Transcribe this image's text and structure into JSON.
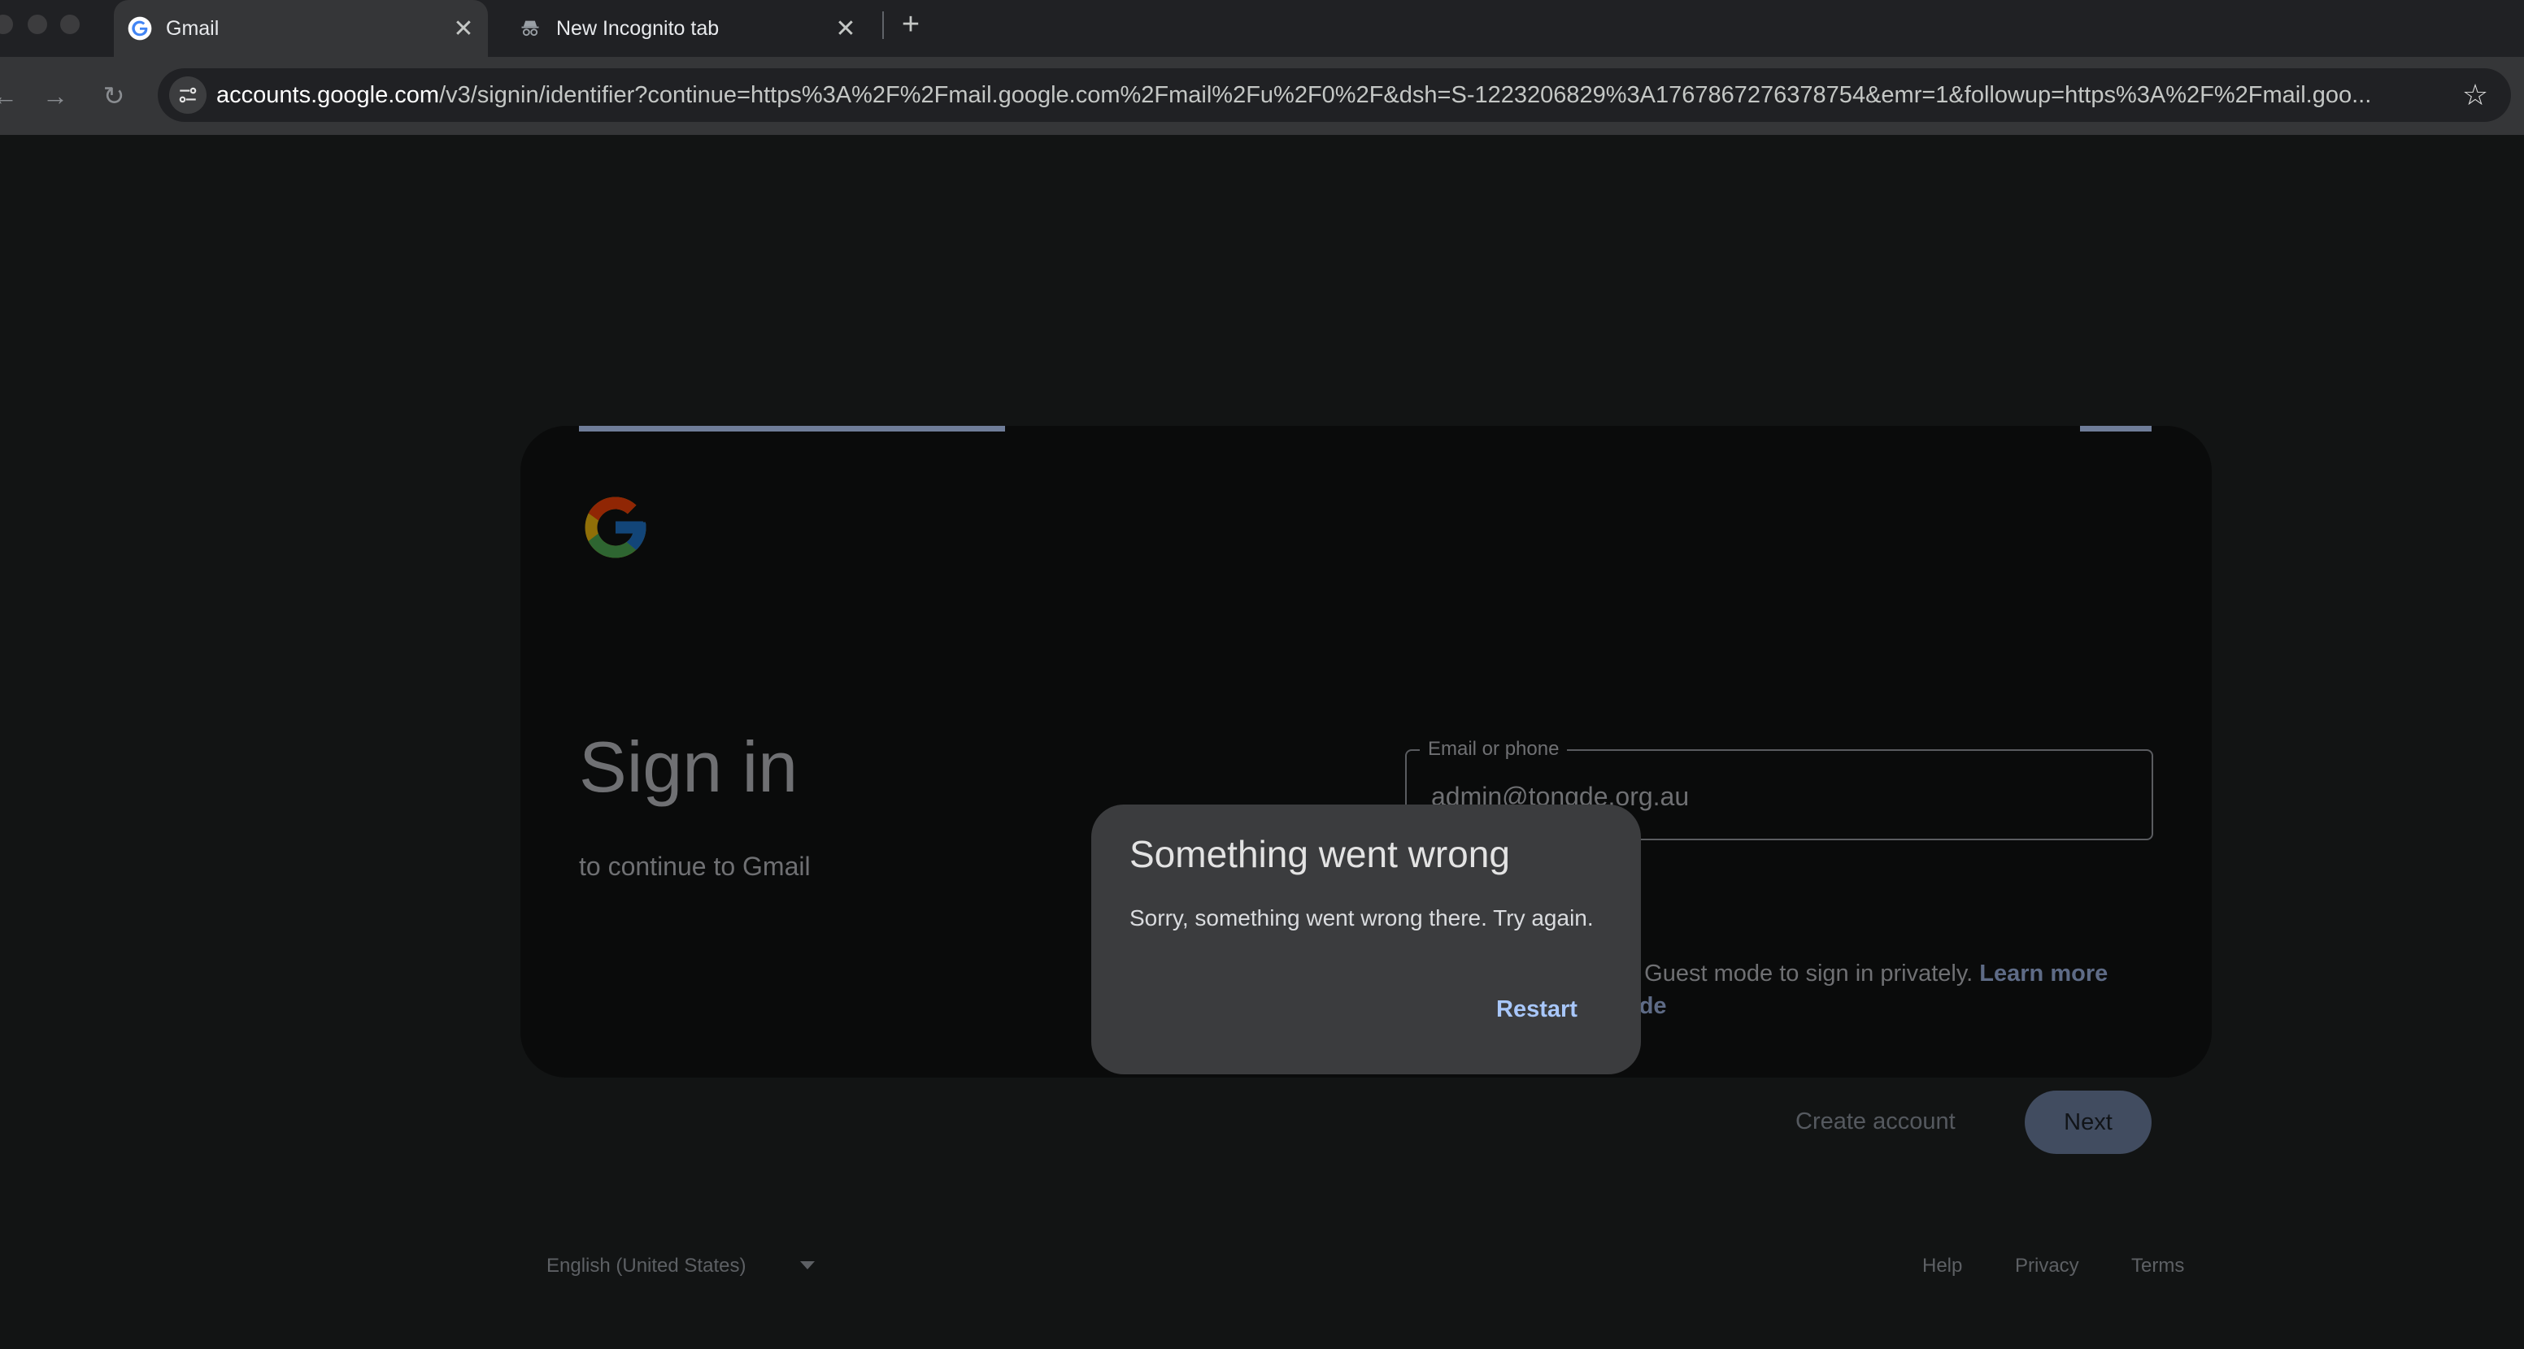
{
  "browser": {
    "tabs": [
      {
        "title": "Gmail",
        "icon": "google-g-icon",
        "active": true
      },
      {
        "title": "New Incognito tab",
        "icon": "incognito-icon",
        "active": false
      }
    ],
    "address_bar": {
      "host": "accounts.google.com",
      "path": "/v3/signin/identifier?continue=https%3A%2F%2Fmail.google.com%2Fmail%2Fu%2F0%2F&dsh=S-1223206829%3A1767867276378754&emr=1&followup=https%3A%2F%2Fmail.goo..."
    }
  },
  "signin": {
    "heading": "Sign in",
    "subheading": "to continue to Gmail",
    "email_label": "Email or phone",
    "email_value": "admin@tongde.org.au",
    "guest_text": "e Guest mode to sign in privately.",
    "guest_link": "Learn more",
    "guest_link_cont": "ode",
    "create_account": "Create account",
    "next": "Next"
  },
  "footer": {
    "language": "English (United States)",
    "help": "Help",
    "privacy": "Privacy",
    "terms": "Terms"
  },
  "dialog": {
    "title": "Something went wrong",
    "message": "Sorry, something went wrong there. Try again.",
    "restart": "Restart"
  },
  "colors": {
    "page_bg": "#121414",
    "dialog_bg": "#3b3c3e",
    "accent_link": "#a8c7fa"
  }
}
